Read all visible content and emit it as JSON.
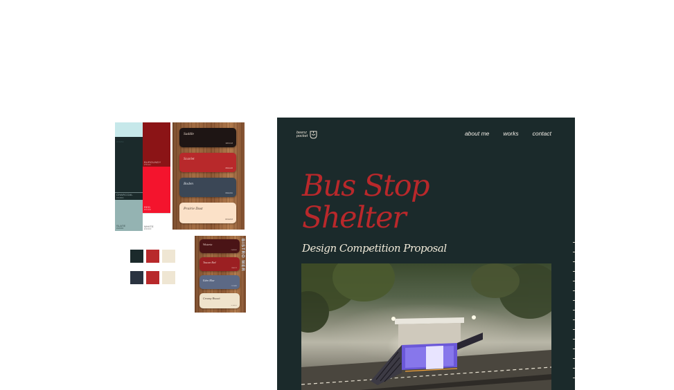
{
  "palette_board": {
    "col_a": [
      {
        "name": "WISP",
        "code": "#C6E8EA",
        "color": "#c6e8ea",
        "text_color": "#3a5557"
      },
      {
        "name": "",
        "code": "",
        "color": "#1b2a2b",
        "text_color": "#9fb3b4"
      },
      {
        "name": "CHARCOAL",
        "code": "#1C2B2C",
        "color": "#1b2a2b",
        "text_color": "#9fb3b4"
      },
      {
        "name": "SLATE",
        "code": "#94B3B2",
        "color": "#94b3b2",
        "text_color": "#2f4443"
      }
    ],
    "col_b": [
      {
        "name": "BURGUNDY",
        "code": "#7F1114",
        "color": "#8b1416",
        "text_color": "#e5b6b6"
      },
      {
        "name": "RED",
        "code": "#FF1133",
        "color": "#f4142d",
        "text_color": "#ffd0d5"
      },
      {
        "name": "WHITE",
        "code": "#FFFFFF",
        "color": "#ffffff",
        "text_color": "#555555"
      }
    ]
  },
  "card_board_1": [
    {
      "name": "Saddle",
      "code": "#2F1C18",
      "color": "#1e1514",
      "text_color": "#e9d8cb"
    },
    {
      "name": "Scarlet",
      "code": "#B62A2B",
      "color": "#b8292b",
      "text_color": "#f6d9d2"
    },
    {
      "name": "Boden",
      "code": "#3E4A5A",
      "color": "#3b4756",
      "text_color": "#dfe4ea"
    },
    {
      "name": "Prairie Dust",
      "code": "#FFE3C8",
      "color": "#fbe1c8",
      "text_color": "#4b3a2f"
    }
  ],
  "card_board_2": [
    {
      "name": "Wisteria",
      "code": "#5A1A1D",
      "color": "#4a1416",
      "text_color": "#f1d9d2"
    },
    {
      "name": "Tuscan Red",
      "code": "#9A1F22",
      "color": "#9b1f22",
      "text_color": "#f1d9d2"
    },
    {
      "name": "Eden Blue",
      "code": "#5C6A85",
      "color": "#5c6985",
      "text_color": "#e9edf5"
    },
    {
      "name": "Creamy Biscuit",
      "code": "#F2E6CF",
      "color": "#efe3cc",
      "text_color": "#4b3a2f"
    }
  ],
  "side_text": "BISTRO MER",
  "small_swatches": {
    "row1": [
      "#1b2a2b",
      "#b8292b",
      "#efe6d3"
    ],
    "row2": [
      "#2a3340",
      "#b8292b",
      "#efe6d3"
    ]
  },
  "site": {
    "background": "#1b2a2b",
    "logo_text_line1": "beenz",
    "logo_text_line2": "pocket",
    "nav": [
      "about me",
      "works",
      "contact"
    ],
    "title_line1": "Bus Stop",
    "title_line2": "Shelter",
    "subtitle": "Design Competition Proposal",
    "accent": "#b9282b"
  }
}
